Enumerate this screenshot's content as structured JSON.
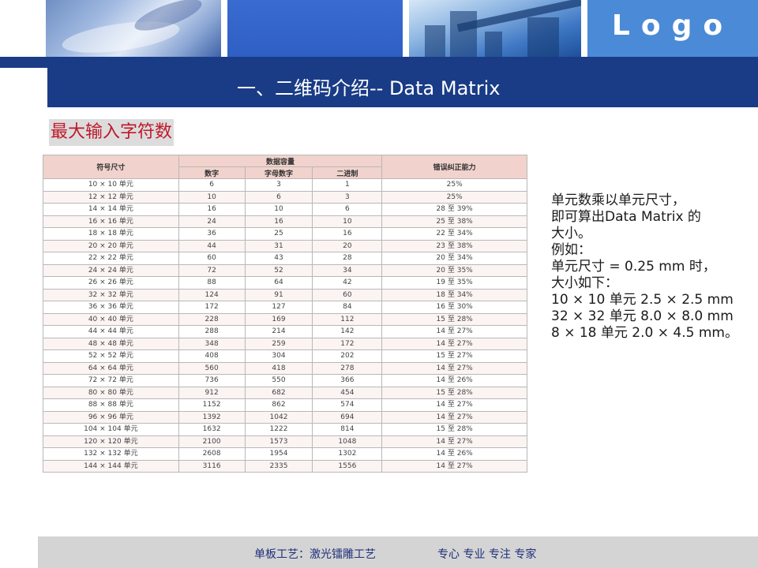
{
  "header": {
    "logo_text": "Logo",
    "title": "一、二维码介绍-- Data Matrix"
  },
  "heading": "最大输入字符数",
  "table": {
    "col_symbol": "符号尺寸",
    "col_capacity": "数据容量",
    "col_numeric": "数字",
    "col_alnum": "字母数字",
    "col_binary": "二进制",
    "col_ecc": "错误纠正能力",
    "rows": [
      [
        "10 × 10 单元",
        "6",
        "3",
        "1",
        "25%"
      ],
      [
        "12 × 12 单元",
        "10",
        "6",
        "3",
        "25%"
      ],
      [
        "14 × 14 单元",
        "16",
        "10",
        "6",
        "28 至 39%"
      ],
      [
        "16 × 16 单元",
        "24",
        "16",
        "10",
        "25 至 38%"
      ],
      [
        "18 × 18 单元",
        "36",
        "25",
        "16",
        "22 至 34%"
      ],
      [
        "20 × 20 单元",
        "44",
        "31",
        "20",
        "23 至 38%"
      ],
      [
        "22 × 22 单元",
        "60",
        "43",
        "28",
        "20 至 34%"
      ],
      [
        "24 × 24 单元",
        "72",
        "52",
        "34",
        "20 至 35%"
      ],
      [
        "26 × 26 单元",
        "88",
        "64",
        "42",
        "19 至 35%"
      ],
      [
        "32 × 32 单元",
        "124",
        "91",
        "60",
        "18 至 34%"
      ],
      [
        "36 × 36 单元",
        "172",
        "127",
        "84",
        "16 至 30%"
      ],
      [
        "40 × 40 单元",
        "228",
        "169",
        "112",
        "15 至 28%"
      ],
      [
        "44 × 44 单元",
        "288",
        "214",
        "142",
        "14 至 27%"
      ],
      [
        "48 × 48 单元",
        "348",
        "259",
        "172",
        "14 至 27%"
      ],
      [
        "52 × 52 单元",
        "408",
        "304",
        "202",
        "15 至 27%"
      ],
      [
        "64 × 64 单元",
        "560",
        "418",
        "278",
        "14 至 27%"
      ],
      [
        "72 × 72 单元",
        "736",
        "550",
        "366",
        "14 至 26%"
      ],
      [
        "80 × 80 单元",
        "912",
        "682",
        "454",
        "15 至 28%"
      ],
      [
        "88 × 88 单元",
        "1152",
        "862",
        "574",
        "14 至 27%"
      ],
      [
        "96 × 96 单元",
        "1392",
        "1042",
        "694",
        "14 至 27%"
      ],
      [
        "104 × 104 单元",
        "1632",
        "1222",
        "814",
        "15 至 28%"
      ],
      [
        "120 × 120 单元",
        "2100",
        "1573",
        "1048",
        "14 至 27%"
      ],
      [
        "132 × 132 单元",
        "2608",
        "1954",
        "1302",
        "14 至 26%"
      ],
      [
        "144 × 144 单元",
        "3116",
        "2335",
        "1556",
        "14 至 27%"
      ]
    ]
  },
  "side_text": [
    "单元数乘以单元尺寸，",
    "即可算出Data Matrix 的",
    "大小。",
    "例如：",
    "单元尺寸 = 0.25 mm 时，",
    "大小如下：",
    "10 × 10 单元 2.5 × 2.5 mm",
    "32 × 32 单元 8.0 × 8.0 mm",
    "8 × 18 单元 2.0 × 4.5 mm。"
  ],
  "footer": {
    "left": "单板工艺：激光镭雕工艺",
    "right": "专心 专业 专注 专家"
  },
  "colors": {
    "title_band": "#1a3c86",
    "heading_text": "#c0182a",
    "table_header_bg": "#f1d2cc",
    "footer_bg": "#d4d4d4",
    "footer_text": "#1e2f7a"
  }
}
